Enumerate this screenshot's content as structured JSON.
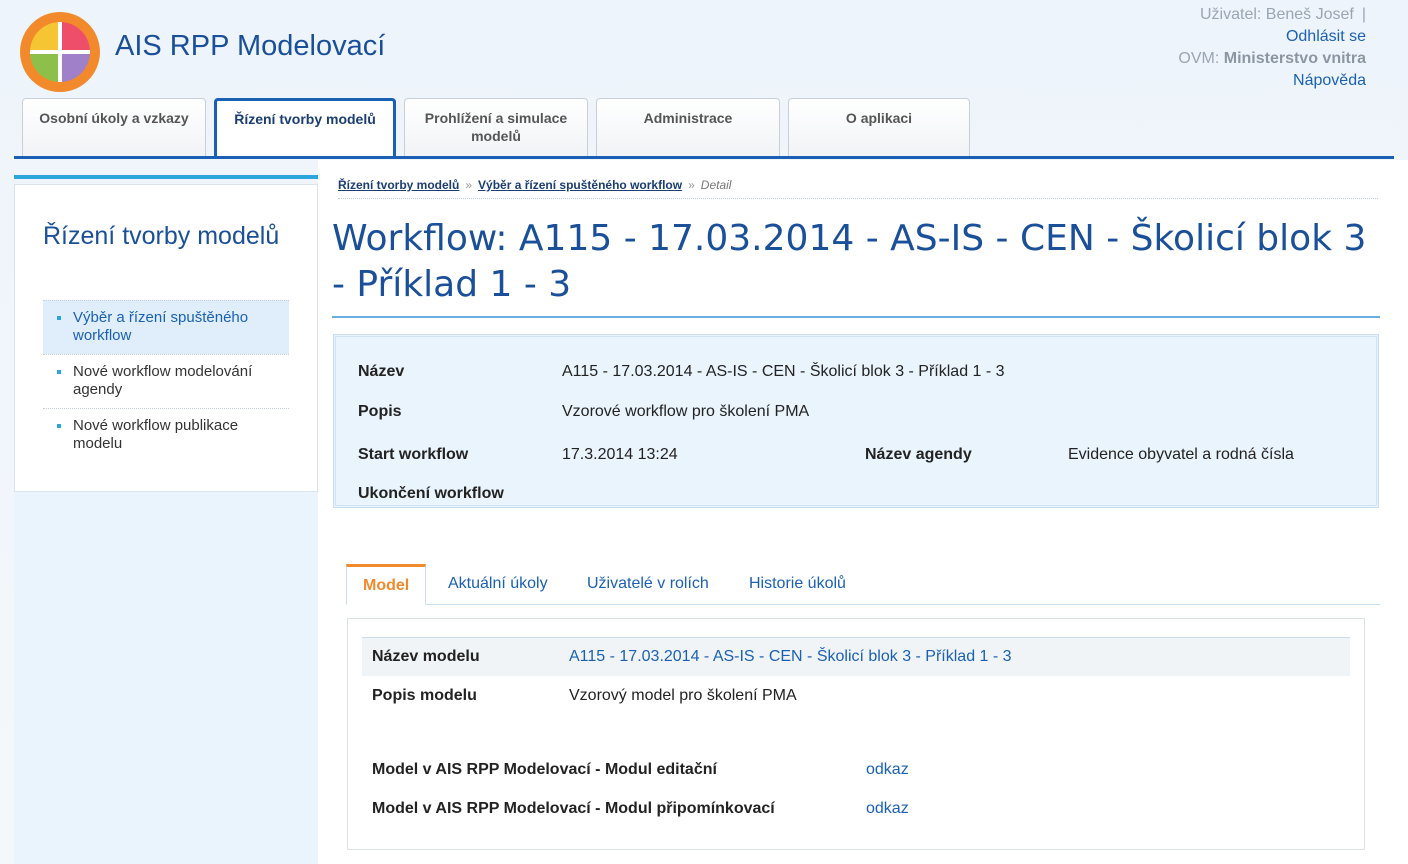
{
  "header": {
    "app_title": "AIS RPP Modelovací",
    "user_label": "Uživatel: Beneš Josef",
    "user_sep": "|",
    "logout": "Odhlásit se",
    "ovm_prefix": "OVM:",
    "ovm_name": "Ministerstvo vnitra",
    "help": "Nápověda"
  },
  "tabs": [
    {
      "label": "Osobní úkoly a vzkazy"
    },
    {
      "label": "Řízení tvorby modelů"
    },
    {
      "label": "Prohlížení a simulace modelů"
    },
    {
      "label": "Administrace"
    },
    {
      "label": "O aplikaci"
    }
  ],
  "sidebar": {
    "title": "Řízení tvorby modelů",
    "items": [
      {
        "label": "Výběr a řízení spuštěného workflow"
      },
      {
        "label": "Nové workflow modelování agendy"
      },
      {
        "label": "Nové workflow publikace modelu"
      }
    ]
  },
  "breadcrumb": {
    "item1": "Řízení tvorby modelů",
    "item2": "Výběr a řízení spuštěného workflow",
    "current": "Detail",
    "sep": "»"
  },
  "page_title": "Workflow: A115 - 17.03.2014 - AS-IS - CEN - Školicí blok 3 - Příklad 1 - 3",
  "info": {
    "name_label": "Název",
    "name_value": "A115 - 17.03.2014 - AS-IS - CEN - Školicí blok 3 - Příklad 1 - 3",
    "desc_label": "Popis",
    "desc_value": "Vzorové workflow pro školení PMA",
    "start_label": "Start workflow",
    "start_value": "17.3.2014 13:24",
    "agenda_label": "Název agendy",
    "agenda_value": "Evidence obyvatel a rodná čísla",
    "end_label": "Ukončení workflow"
  },
  "content_tabs": [
    {
      "label": "Model"
    },
    {
      "label": "Aktuální úkoly"
    },
    {
      "label": "Uživatelé v rolích"
    },
    {
      "label": "Historie úkolů"
    }
  ],
  "model": {
    "name_label": "Název modelu",
    "name_value": "A115 - 17.03.2014 - AS-IS - CEN - Školicí blok 3 - Příklad 1 - 3",
    "desc_label": "Popis modelu",
    "desc_value": "Vzorový model pro školení PMA",
    "edit_label": "Model v AIS RPP Modelovací - Modul editační",
    "edit_link": "odkaz",
    "comment_label": "Model v AIS RPP Modelovací - Modul připomínkovací",
    "comment_link": "odkaz"
  },
  "colors": {
    "brand_blue": "#1a60b5",
    "accent_orange": "#f08a2c",
    "light_blue_bg": "#eaf4fc"
  }
}
